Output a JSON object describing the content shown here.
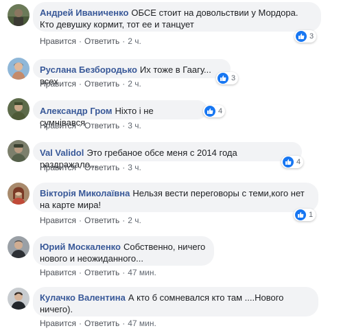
{
  "actions": {
    "like": "Нравится",
    "reply": "Ответить",
    "sep": "·"
  },
  "colors": {
    "author": "#385898",
    "bubble": "#f2f3f5",
    "like": "#1877f2"
  },
  "comments": [
    {
      "author": "Андрей Иваниченко",
      "text": "ОБСЕ стоит на довольствии у Мордора. Кто девушку кормит, тот ее и танцует",
      "likes": "3",
      "time": "2 ч."
    },
    {
      "author": "Руслана Безбородько",
      "text": "Их тоже в Гаагу... всех",
      "likes": "3",
      "time": "2 ч."
    },
    {
      "author": "Александр Гром",
      "text": "Ніхто і не сумнівався",
      "likes": "4",
      "time": "3 ч."
    },
    {
      "author": "Val Validol",
      "text": "Это гребаное обсе меня с 2014 года раздражало...",
      "likes": "4",
      "time": "3 ч."
    },
    {
      "author": "Вікторія Миколаївна",
      "text": "Нельзя вести переговоры с теми,кого нет на карте мира!",
      "likes": "1",
      "time": "2 ч."
    },
    {
      "author": "Юрий Москаленко",
      "text": "Собственно, ничего нового и неожиданного...",
      "likes": "",
      "time": "47 мин."
    },
    {
      "author": "Кулачко Валентина",
      "text": "А кто б сомневался кто там ....Нового ничего).",
      "likes": "",
      "time": "47 мин."
    }
  ]
}
